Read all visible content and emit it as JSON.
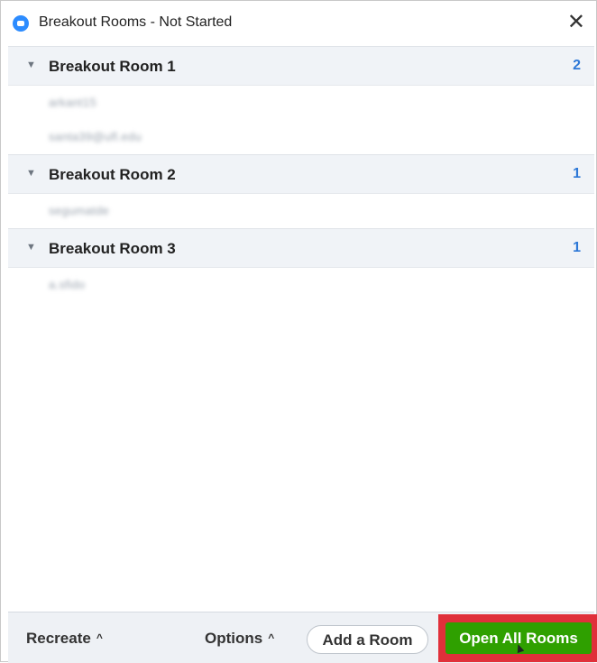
{
  "window": {
    "title": "Breakout Rooms - Not Started",
    "close_glyph": "✕",
    "app_icon": "zoom-logo-icon"
  },
  "rooms": [
    {
      "name": "Breakout Room 1",
      "count": "2",
      "participants": [
        "arkant15",
        "santa39@ufl.edu"
      ]
    },
    {
      "name": "Breakout Room 2",
      "count": "1",
      "participants": [
        "segumatde"
      ]
    },
    {
      "name": "Breakout Room 3",
      "count": "1",
      "participants": [
        "a.sfido"
      ]
    }
  ],
  "footer": {
    "recreate_label": "Recreate",
    "options_label": "Options",
    "chevron_glyph": "^",
    "add_room_label": "Add a Room",
    "open_all_label": "Open All Rooms"
  },
  "colors": {
    "room_count": "#2d78d7",
    "primary_button": "#2fa000",
    "highlight_box": "#e0303a",
    "header_bg": "#f0f3f7"
  }
}
